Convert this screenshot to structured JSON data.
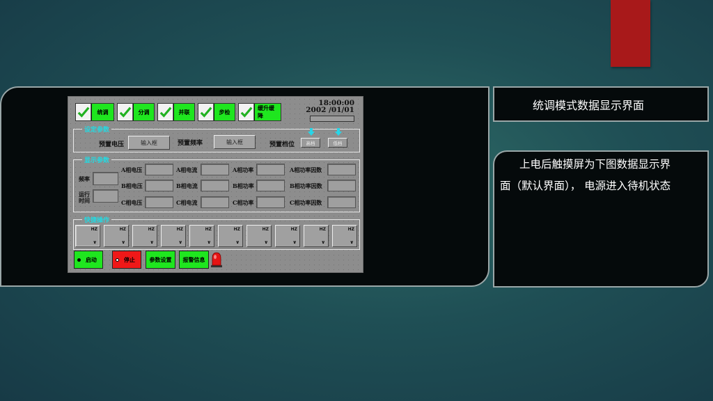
{
  "caption_title": "统调模式数据显示界面",
  "caption_desc_line1": "上电后触摸屏为下图数据显示界",
  "caption_desc_line2": "面（默认界面）， 电源进入待机状态",
  "hmi": {
    "mode_tabs": [
      {
        "label": "统调",
        "checked": true
      },
      {
        "label": "分调",
        "checked": true
      },
      {
        "label": "并联",
        "checked": true
      },
      {
        "label": "步检",
        "checked": true
      },
      {
        "label": "缓升缓降",
        "checked": true
      }
    ],
    "time": "18:00:00",
    "date": "2002 /01/01",
    "settings": {
      "legend": "设定参数",
      "voltage_label": "预置电压",
      "voltage_input": "输入框",
      "freq_label": "预置频率",
      "freq_input": "输入框",
      "gear_label": "预置档位",
      "gear_high": "高档",
      "gear_low": "低档"
    },
    "display": {
      "legend": "显示参数",
      "freq_label": "频率",
      "runtime_label": "运行\n时间",
      "rows": [
        [
          "A相电压",
          "A相电流",
          "A相功率",
          "A相功率因数"
        ],
        [
          "B相电压",
          "B相电流",
          "B相功率",
          "B相功率因数"
        ],
        [
          "C相电压",
          "C相电流",
          "C相功率",
          "C相功率因数"
        ]
      ]
    },
    "quick": {
      "legend": "快捷操作",
      "unit": "HZ",
      "arrow": "∨",
      "count": 10
    },
    "buttons": {
      "start": "启动",
      "stop": "停止",
      "params": "参数设置",
      "alarm": "报警信息"
    }
  },
  "colors": {
    "accent_green": "#1fe61f",
    "accent_red": "#ef1818",
    "legend_cyan": "#26d8e0",
    "tab_red": "#a8191a"
  }
}
